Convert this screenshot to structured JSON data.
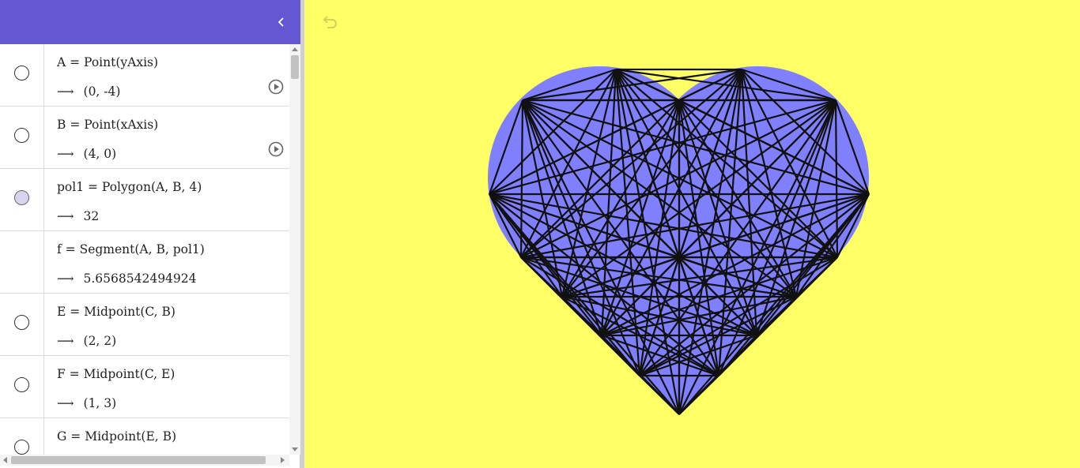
{
  "colors": {
    "header": "#6557d2",
    "graphics_background": "#ffff66",
    "heart_fill": "#8080ff",
    "segment_stroke": "#111111"
  },
  "header": {
    "collapse_icon": "chevron-left-icon"
  },
  "algebra": {
    "rows": [
      {
        "definition": "A = Point(yAxis)",
        "value": "(0, -4)",
        "visible": false,
        "has_play": true
      },
      {
        "definition": "B = Point(xAxis)",
        "value": "(4, 0)",
        "visible": false,
        "has_play": true
      },
      {
        "definition": "pol1 = Polygon(A, B, 4)",
        "value": "32",
        "visible": true,
        "has_play": false
      },
      {
        "definition": "f = Segment(A, B, pol1)",
        "value": "5.6568542494924",
        "visible": null,
        "has_play": false
      },
      {
        "definition": "E = Midpoint(C, B)",
        "value": "(2, 2)",
        "visible": false,
        "has_play": false
      },
      {
        "definition": "F = Midpoint(C, E)",
        "value": "(1, 3)",
        "visible": false,
        "has_play": false
      },
      {
        "definition": "G = Midpoint(E, B)",
        "value": "",
        "visible": false,
        "has_play": false
      }
    ]
  },
  "graphics": {
    "undo_icon": "undo-icon"
  }
}
